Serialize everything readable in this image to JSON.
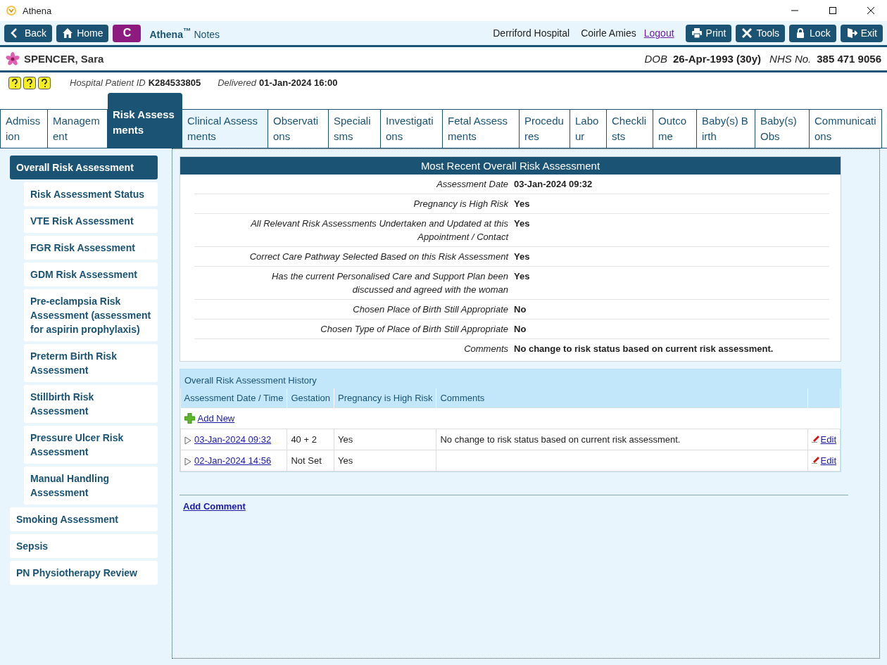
{
  "window": {
    "title": "Athena"
  },
  "toolbar": {
    "nav_buttons": [
      "Back",
      "Home"
    ],
    "app_badge": "C",
    "app_name": "Athena",
    "app_name_mark": "™",
    "app_suffix": "Notes",
    "hospital": "Derriford Hospital",
    "user": "Coirle Amies",
    "logout": "Logout",
    "actions": [
      "Print",
      "Tools",
      "Lock",
      "Exit"
    ]
  },
  "patient": {
    "name": "SPENCER, Sara",
    "dob_label": "DOB",
    "dob": "26-Apr-1993 (30y)",
    "nhs_label": "NHS No.",
    "nhs": "385 471 9056",
    "hospital_id_label": "Hospital Patient ID",
    "hospital_id": "K284533805",
    "delivered_label": "Delivered",
    "delivered": "01-Jan-2024 16:00"
  },
  "tabs": [
    {
      "label": "Admission",
      "selected": false,
      "highlighted": false
    },
    {
      "label": "Management",
      "selected": false,
      "highlighted": false
    },
    {
      "label": "Risk Assessments",
      "selected": true,
      "highlighted": false
    },
    {
      "label": "Clinical Assessments",
      "selected": false,
      "highlighted": true
    },
    {
      "label": "Observations",
      "selected": false,
      "highlighted": false
    },
    {
      "label": "Specialisms",
      "selected": false,
      "highlighted": false
    },
    {
      "label": "Investigations",
      "selected": false,
      "highlighted": false
    },
    {
      "label": "Fetal Assessments",
      "selected": false,
      "highlighted": false
    },
    {
      "label": "Procedures",
      "selected": false,
      "highlighted": false
    },
    {
      "label": "Labour",
      "selected": false,
      "highlighted": false
    },
    {
      "label": "Checklists",
      "selected": false,
      "highlighted": false
    },
    {
      "label": "Outcome",
      "selected": false,
      "highlighted": false
    },
    {
      "label": "Baby(s) Birth",
      "selected": false,
      "highlighted": false
    },
    {
      "label": "Baby(s) Obs",
      "selected": false,
      "highlighted": false
    },
    {
      "label": "Communications",
      "selected": false,
      "highlighted": false
    }
  ],
  "sidebar": {
    "items": [
      {
        "label": "Overall Risk Assessment",
        "selected": true,
        "children": [
          {
            "label": "Risk Assessment Status",
            "selected": false
          },
          {
            "label": "VTE Risk Assessment",
            "selected": false
          },
          {
            "label": "FGR Risk Assessment",
            "selected": false
          },
          {
            "label": "GDM Risk Assessment",
            "selected": false
          },
          {
            "label": "Pre-eclampsia Risk Assessment (assessment for aspirin prophylaxis)",
            "selected": false
          },
          {
            "label": "Preterm Birth Risk Assessment",
            "selected": false
          },
          {
            "label": "Stillbirth Risk Assessment",
            "selected": false
          },
          {
            "label": "Pressure Ulcer Risk Assessment",
            "selected": false
          },
          {
            "label": "Manual Handling Assessment",
            "selected": false
          }
        ]
      },
      {
        "label": "Smoking Assessment",
        "selected": false
      },
      {
        "label": "Sepsis",
        "selected": false
      },
      {
        "label": "PN Physiotherapy Review",
        "selected": false
      }
    ]
  },
  "recent": {
    "title": "Most Recent Overall Risk Assessment",
    "fields": [
      {
        "label": "Assessment Date",
        "value": "03-Jan-2024 09:32"
      },
      {
        "label": "Pregnancy is High Risk",
        "value": "Yes"
      },
      {
        "label": "All Relevant Risk Assessments Undertaken and Updated at this Appointment / Contact",
        "value": "Yes"
      },
      {
        "label": "Correct Care Pathway Selected Based on this Risk Assessment",
        "value": "Yes"
      },
      {
        "label": "Has the current Personalised Care and Support Plan been discussed and agreed with the woman",
        "value": "Yes"
      },
      {
        "label": "Chosen Place of Birth Still Appropriate",
        "value": "No"
      },
      {
        "label": "Chosen Type of Place of Birth Still Appropriate",
        "value": "No"
      },
      {
        "label": "Comments",
        "value": "No change to risk status based on current risk assessment."
      }
    ]
  },
  "history": {
    "title": "Overall Risk Assessment History",
    "columns": [
      "Assessment Date / Time",
      "Gestation",
      "Pregnancy is High Risk",
      "Comments"
    ],
    "add_new": "Add New",
    "rows": [
      {
        "date": "03-Jan-2024 09:32",
        "gestation": "40 + 2",
        "high_risk": "Yes",
        "comments": "No change to risk status based on current risk assessment.",
        "edit": "Edit"
      },
      {
        "date": "02-Jan-2024 14:56",
        "gestation": "Not Set",
        "high_risk": "Yes",
        "comments": "",
        "edit": "Edit"
      }
    ]
  },
  "add_comment": "Add Comment"
}
